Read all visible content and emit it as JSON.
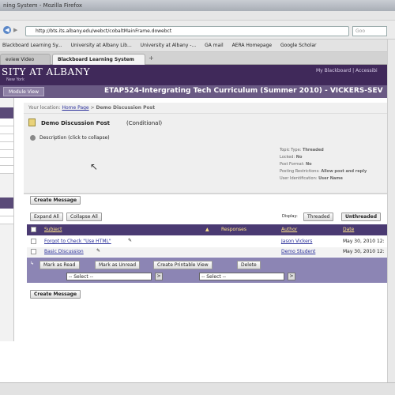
{
  "window": {
    "title": "ning System - Mozilla Firefox"
  },
  "browser": {
    "url": "http://bts.its.albany.edu/webct/cobaltMainFrame.dowebct",
    "bookmarks": [
      "Blackboard Learning Sy...",
      "University at Albany Lib...",
      "University at Albany -...",
      "GA mail",
      "AERA Homepage",
      "Google Scholar"
    ],
    "tabs": [
      "eview Video",
      "Blackboard Learning System"
    ]
  },
  "header": {
    "logo": "SITY AT ALBANY",
    "logo_sub": "New York",
    "links": "My Blackboard | Accessibi",
    "module_button": "Module View",
    "course_title": "ETAP524-Intergrating Tech Curriculum (Summer 2010) - VICKERS-SEV"
  },
  "breadcrumb": {
    "part1": "Your location:",
    "part2": "Home Page",
    "sep": ">",
    "current": "Demo Discussion Post"
  },
  "post": {
    "title": "Demo Discussion Post",
    "mode": "(Conditional)",
    "description_toggle": "Description (click to collapse)",
    "props": [
      {
        "label": "Topic Type:",
        "value": "Threaded"
      },
      {
        "label": "Locked:",
        "value": "No"
      },
      {
        "label": "Post Format:",
        "value": "No"
      },
      {
        "label": "Posting Restrictions:",
        "value": "Allow post and reply"
      },
      {
        "label": "User Identification:",
        "value": "User Name"
      }
    ]
  },
  "buttons": {
    "create_message": "Create Message",
    "expand_all": "Expand All",
    "collapse_all": "Collapse All",
    "display_label": "Display:",
    "threaded": "Threaded",
    "unthreaded": "Unthreaded"
  },
  "table": {
    "columns": [
      "Subject",
      "Responses",
      "Author",
      "Date"
    ],
    "rows": [
      {
        "subject": "Forgot to Check \"Use HTML\"",
        "author": "Jason Vickers",
        "date": "May 30, 2010 12:"
      },
      {
        "subject": "Basic Discussion",
        "author": "Demo Student",
        "date": "May 30, 2010 12:"
      }
    ]
  },
  "actions": {
    "mark_read": "Mark as Read",
    "mark_unread": "Mark as Unread",
    "printable": "Create Printable View",
    "delete": "Delete",
    "select1": "-- Select --",
    "select2": "-- Select --",
    "go": ">"
  }
}
